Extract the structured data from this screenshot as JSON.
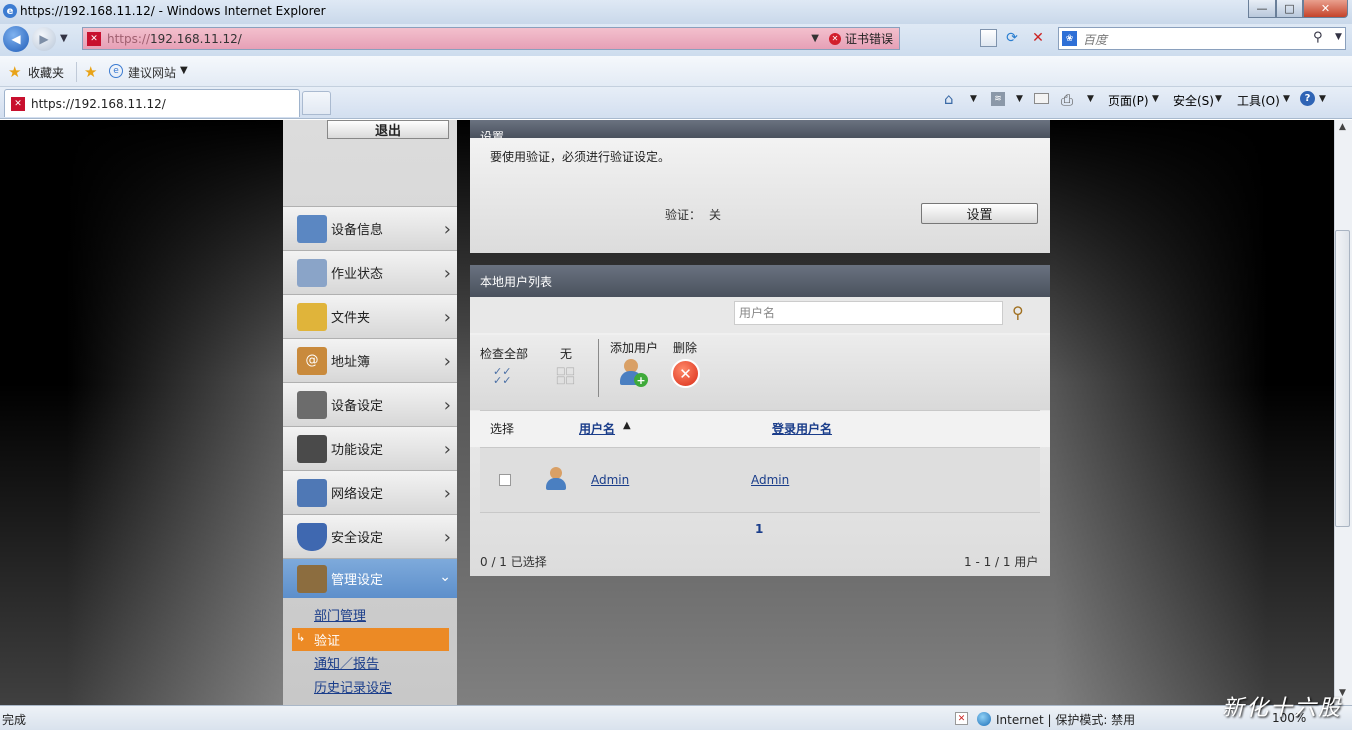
{
  "window": {
    "title": "https://192.168.11.12/ - Windows Internet Explorer",
    "minimize": "—",
    "maximize": "□",
    "close": "✕"
  },
  "address_bar": {
    "scheme": "https://",
    "host": "192.168.11.12/",
    "cert_error": "证书错误"
  },
  "search": {
    "placeholder": "百度"
  },
  "favorites": {
    "label": "收藏夹",
    "suggested": "建议网站"
  },
  "tab": {
    "title": "https://192.168.11.12/"
  },
  "command_bar": {
    "page": "页面(P)",
    "safety": "安全(S)",
    "tools": "工具(O)"
  },
  "sidebar": {
    "logout": "退出",
    "items": [
      {
        "label": "设备信息",
        "icon": "device-info-icon",
        "color": "#5b87c2"
      },
      {
        "label": "作业状态",
        "icon": "job-status-icon",
        "color": "#8aa4c8"
      },
      {
        "label": "文件夹",
        "icon": "folder-icon",
        "color": "#e0b43a"
      },
      {
        "label": "地址簿",
        "icon": "address-book-icon",
        "color": "#c98a3c"
      },
      {
        "label": "设备设定",
        "icon": "device-settings-icon",
        "color": "#6c6c6c"
      },
      {
        "label": "功能设定",
        "icon": "function-settings-icon",
        "color": "#4a4a4a"
      },
      {
        "label": "网络设定",
        "icon": "network-settings-icon",
        "color": "#4f78b5"
      },
      {
        "label": "安全设定",
        "icon": "security-settings-icon",
        "color": "#3f68b0"
      },
      {
        "label": "管理设定",
        "icon": "management-settings-icon",
        "color": "#8c6d3f"
      }
    ],
    "subitems": [
      "部门管理",
      "验证",
      "通知／报告",
      "历史记录设定"
    ]
  },
  "settings_panel": {
    "heading_partial": "设置",
    "description": "要使用验证，必须进行验证设定。",
    "auth_label": "验证：",
    "auth_value": "关",
    "settings_button": "设置"
  },
  "user_list": {
    "title": "本地用户列表",
    "search_placeholder": "用户名",
    "check_all": "检查全部",
    "none": "无",
    "add_user": "添加用户",
    "delete": "删除",
    "columns": {
      "select": "选择",
      "username": "用户名",
      "login_name": "登录用户名"
    },
    "sort_indicator": "▲",
    "rows": [
      {
        "username": "Admin",
        "login_name": "Admin"
      }
    ],
    "page": "1",
    "selected_count": "0 / 1 已选择",
    "range": "1 - 1 / 1 用户"
  },
  "status": {
    "left": "完成",
    "zone": "Internet | 保护模式: 禁用",
    "zoom": "100%",
    "watermark": "新化十六股"
  }
}
